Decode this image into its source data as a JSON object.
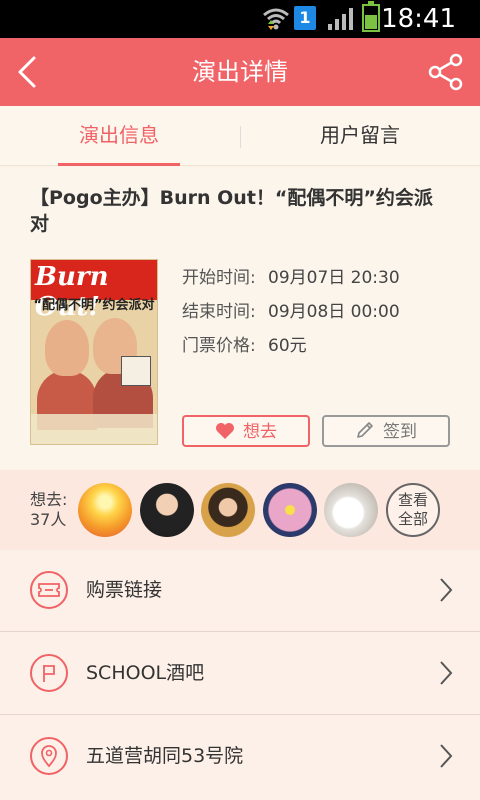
{
  "status_bar": {
    "time": "18:41",
    "notification_badge": "1"
  },
  "header": {
    "title": "演出详情",
    "back_icon": "back-arrow-icon",
    "share_icon": "share-icon"
  },
  "tabs": [
    {
      "label": "演出信息",
      "selected": true
    },
    {
      "label": "用户留言",
      "selected": false
    }
  ],
  "event": {
    "title": "【Pogo主办】Burn Out！“配偶不明”约会派对",
    "poster": {
      "headline": "Burn Out!",
      "subtitle": "“配偶不明”约会派对"
    },
    "info": [
      {
        "label": "开始时间:",
        "value": "09月07日 20:30"
      },
      {
        "label": "结束时间:",
        "value": "09月08日 00:00"
      },
      {
        "label": "门票价格:",
        "value": "60元"
      }
    ],
    "want_button": "想去",
    "signin_button": "签到"
  },
  "attendees": {
    "label_line1": "想去:",
    "label_line2": "37人",
    "view_all_line1": "查看",
    "view_all_line2": "全部"
  },
  "links": [
    {
      "label": "购票链接",
      "icon": "ticket-icon"
    },
    {
      "label": "SCHOOL酒吧",
      "icon": "flag-icon"
    },
    {
      "label": "五道营胡同53号院",
      "icon": "location-pin-icon"
    }
  ],
  "colors": {
    "accent": "#f06366",
    "background": "#fbf3ea"
  }
}
